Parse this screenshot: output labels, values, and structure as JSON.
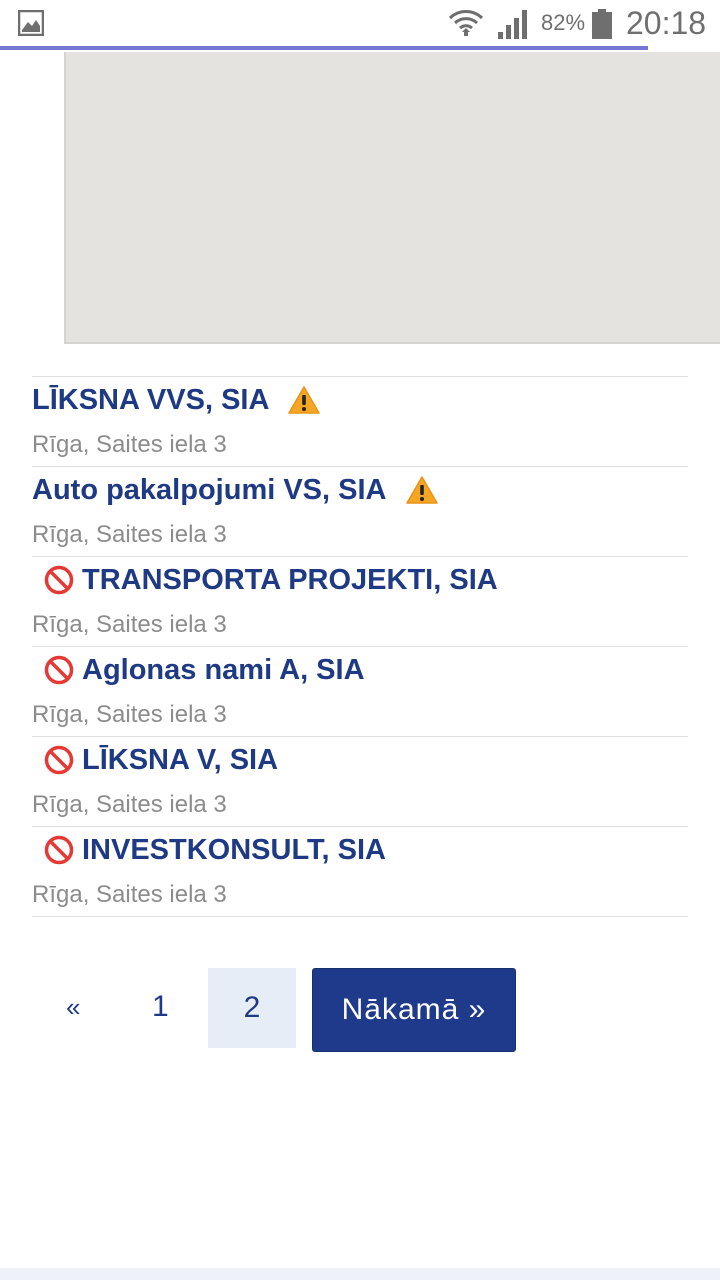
{
  "status_bar": {
    "battery_percent": "82%",
    "time": "20:18",
    "icons": [
      "gallery-icon",
      "wifi-icon",
      "signal-icon",
      "battery-icon"
    ]
  },
  "page_load_progress": 0.9,
  "results": [
    {
      "name": "LĪKSNA VVS, SIA",
      "address": "Rīga, Saites iela 3",
      "status": "warning"
    },
    {
      "name": "Auto pakalpojumi VS, SIA",
      "address": "Rīga, Saites iela 3",
      "status": "warning"
    },
    {
      "name": "TRANSPORTA PROJEKTI, SIA",
      "address": "Rīga, Saites iela 3",
      "status": "liquidated"
    },
    {
      "name": "Aglonas nami A, SIA",
      "address": "Rīga, Saites iela 3",
      "status": "liquidated"
    },
    {
      "name": "LĪKSNA V, SIA",
      "address": "Rīga, Saites iela 3",
      "status": "liquidated"
    },
    {
      "name": "INVESTKONSULT, SIA",
      "address": "Rīga, Saites iela 3",
      "status": "liquidated"
    }
  ],
  "pagination": {
    "prev_label": "«",
    "pages": [
      "1",
      "2"
    ],
    "current_page": "2",
    "next_label": "Nākamā »"
  },
  "colors": {
    "link": "#1f3a84",
    "address": "#8c8c8c",
    "primary_button": "#1f3a8a",
    "progress": "#7478d3",
    "map_placeholder": "#e5e3df"
  }
}
